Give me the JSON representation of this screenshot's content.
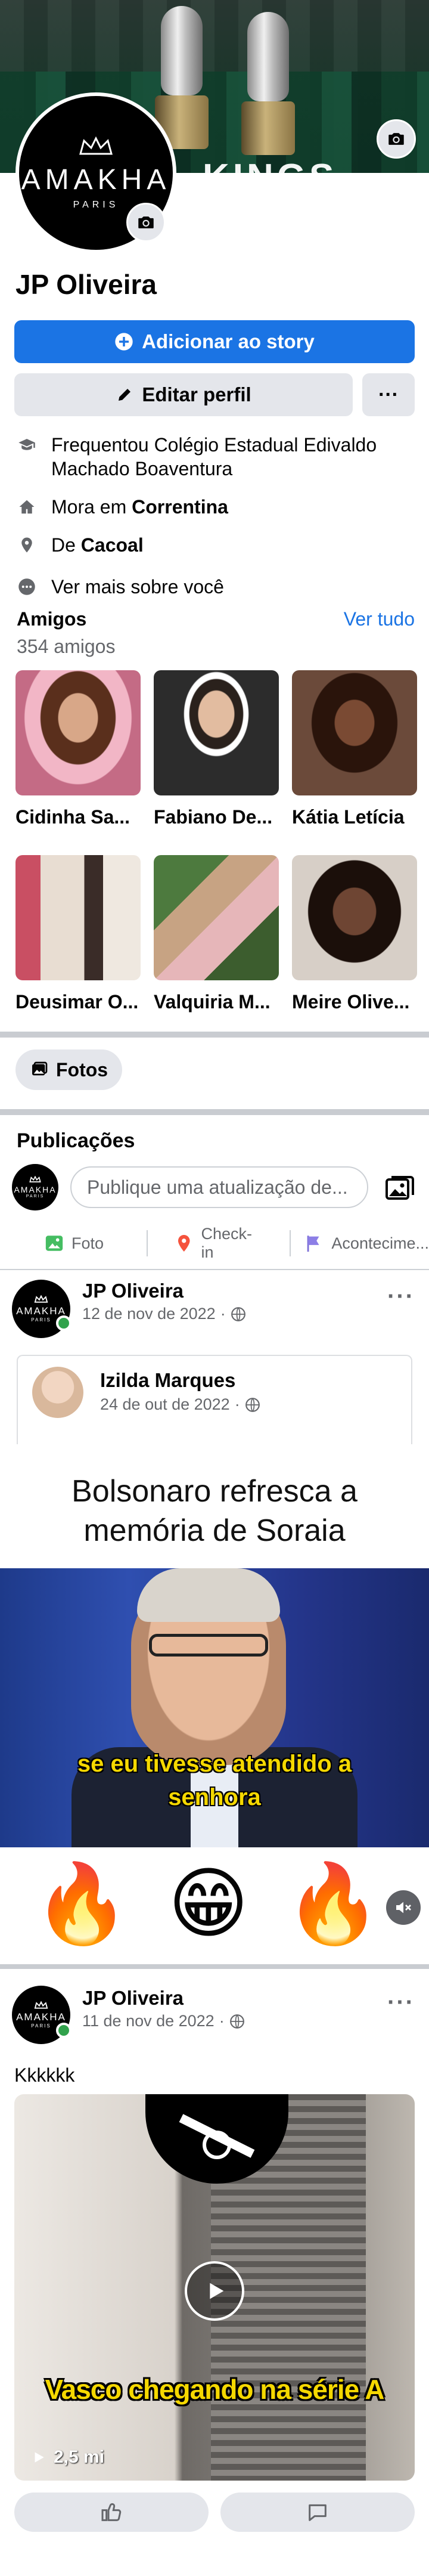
{
  "cover": {
    "text": "KINGS"
  },
  "profile": {
    "brand": "AMAKHA",
    "brand_sub": "PARIS",
    "name": "JP Oliveira",
    "add_story_label": "Adicionar ao story",
    "edit_profile_label": "Editar perfil",
    "more_label": "···"
  },
  "intro": {
    "studied_line1": "Frequentou Colégio Estadual Edivaldo",
    "studied_line2": "Machado Boaventura",
    "lives_prefix": "Mora em ",
    "lives_city": "Correntina",
    "from_prefix": "De ",
    "from_city": "Cacoal",
    "see_more": "Ver mais sobre você"
  },
  "friends": {
    "title": "Amigos",
    "count": "354 amigos",
    "see_all": "Ver tudo",
    "list": [
      {
        "name": "Cidinha Sa..."
      },
      {
        "name": "Fabiano De..."
      },
      {
        "name": "Kátia Letícia"
      },
      {
        "name": "Deusimar O..."
      },
      {
        "name": "Valquiria M..."
      },
      {
        "name": "Meire Olive..."
      }
    ]
  },
  "photos_chip": "Fotos",
  "publications": {
    "title": "Publicações",
    "composer_placeholder": "Publique uma atualização de...",
    "actions": [
      {
        "label": "Foto",
        "icon": "photo-icon"
      },
      {
        "label": "Check-in",
        "icon": "location-pin-icon"
      },
      {
        "label": "Acontecime...",
        "icon": "flag-icon"
      }
    ]
  },
  "post1": {
    "author": "JP Oliveira",
    "date": "12 de nov de 2022",
    "menu": "···",
    "shared_author": "Izilda Marques",
    "shared_date": "24 de out de 2022",
    "title_line1": "Bolsonaro refresca a",
    "title_line2": "memória de Soraia",
    "caption_line1": "se eu tivesse atendido a",
    "caption_line2": "senhora",
    "emojis": [
      "🔥",
      "😁",
      "🔥"
    ]
  },
  "post2": {
    "author": "JP Oliveira",
    "date": "11 de nov de 2022",
    "menu": "···",
    "text": "Kkkkkk",
    "video_caption": "Vasco chegando na série A",
    "views": "2,5 mi"
  },
  "colors": {
    "primary": "#1b74e4",
    "secondary_bg": "#e4e6eb",
    "muted_text": "#65676b",
    "online": "#31a24c",
    "caption_yellow": "#f5d800"
  }
}
